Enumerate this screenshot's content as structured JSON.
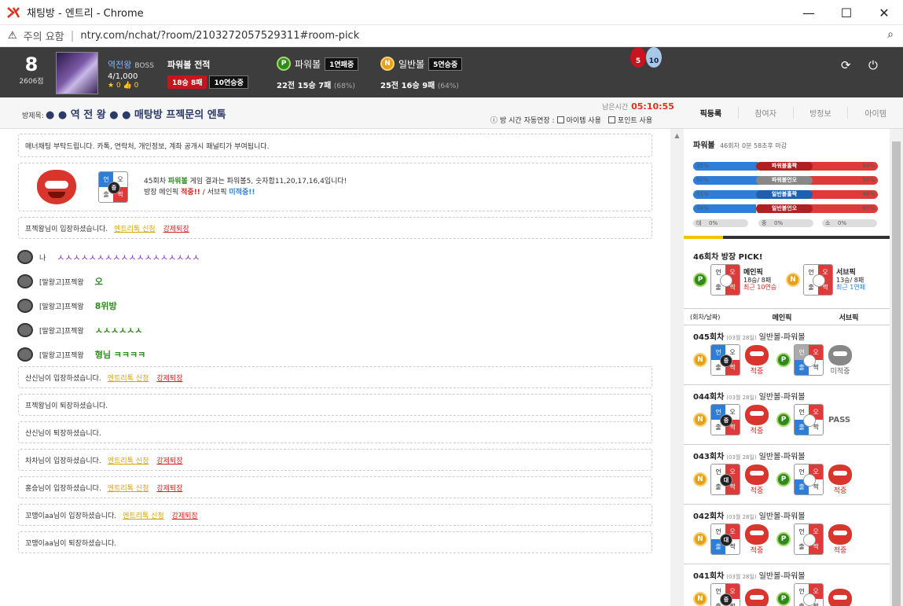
{
  "window": {
    "title": "채팅방 - 엔트리 - Chrome",
    "warning": "주의 요함",
    "url": "ntry.com/nchat/?room/2103272057529311#room-pick"
  },
  "user": {
    "level": "8",
    "points": "2606점",
    "name": "역전왕",
    "role": "BOSS",
    "members": "4/1,000",
    "stars": "0",
    "likes": "0"
  },
  "record": {
    "title": "파워볼 전적",
    "result": "18승 8패",
    "streak": "10연승중"
  },
  "powerball": {
    "ball": "P",
    "name": "파워볼",
    "streak": "1연패중",
    "summary": "22전 15승 7패",
    "pct": "(68%)"
  },
  "normalball": {
    "ball": "N",
    "name": "일반볼",
    "streak": "5연승중",
    "summary": "25전 16승 9패",
    "pct": "(64%)"
  },
  "medals": [
    "5",
    "10"
  ],
  "room": {
    "label": "방제목:",
    "title": "● ● 역 전 왕 ● ● 매탕방 프젝문의 엔톡",
    "remain_label": "남은시간",
    "remain": "05:10:55",
    "auto_label": "방 시간 자동연장 :",
    "opt1": "아이템 사용",
    "opt2": "포인트 사용"
  },
  "tabs": [
    "픽등록",
    "참여자",
    "방정보",
    "아이템"
  ],
  "chat": {
    "notice": "매너채팅 부탁드립니다. 카톡, 연락처, 개인정보, 계좌 공개시 패널티가 부여됩니다.",
    "result_line1_a": "45회차",
    "result_line1_b": "파워볼",
    "result_line1_c": "게임 결과는 파워볼5, 숫자합11,20,17,16,4입니다!",
    "result_line2_a": "방장 메인픽",
    "result_line2_b": "적중!!",
    "result_line2_c": "/ 서브픽",
    "result_line2_d": "미적중!!",
    "pick1": {
      "tl": "언",
      "tr": "오",
      "bl": "출",
      "br": "짝",
      "c": "중"
    },
    "link_apply": "엔트리톡 신청",
    "link_kick": "강제퇴장",
    "enter1": "프젝왕님이 입장하셨습니다.",
    "me_label": "나",
    "me_text": "ㅅㅅㅅㅅㅅㅅㅅㅅㅅㅅㅅㅅㅅㅅㅅㅅㅅㅅ",
    "user2": "[말왕고]프젝왕",
    "msg2": "오",
    "msg3": "8위방",
    "msg4": "ㅅㅅㅅㅅㅅㅅ",
    "msg5": "형님 ㅋㅋㅋㅋ",
    "enter2": "산신님이 입장하셨습니다.",
    "leave1": "프젝왕님이 퇴장하셨습니다.",
    "leave2": "산신님이 퇴장하셨습니다.",
    "enter3": "차차님이 입장하셨습니다.",
    "enter4": "홍승님이 입장하셨습니다.",
    "enter5": "꼬맹이aa님이 입장하셨습니다.",
    "leave3": "꼬맹이aa님이 퇴장하셨습니다."
  },
  "stats": {
    "title": "파워볼",
    "round": "46회차",
    "time": "0분 58초후 마감",
    "bars": [
      {
        "left": "35%",
        "right": "64%",
        "label": "파워볼홀짝",
        "l": 35,
        "r": 64
      },
      {
        "left": "50%",
        "right": "50%",
        "label": "파워볼언오",
        "l": 50,
        "r": 50
      },
      {
        "left": "51%",
        "right": "48%",
        "label": "일반볼홀짝",
        "l": 51,
        "r": 48
      },
      {
        "left": "34%",
        "right": "65%",
        "label": "일반볼언오",
        "l": 34,
        "r": 65
      }
    ],
    "mini": [
      {
        "icon": "대",
        "val": "0%"
      },
      {
        "icon": "중",
        "val": "0%"
      },
      {
        "icon": "소",
        "val": "0%"
      }
    ]
  },
  "pick": {
    "title": "46회차 방장 PICK!",
    "main": {
      "label": "메인픽",
      "rec": "18승/ 8패",
      "streak": "최근 10연승"
    },
    "sub": {
      "label": "서브픽",
      "rec": "13승/ 8패",
      "streak": "최근 1연패"
    }
  },
  "history": {
    "cols": [
      "(회차/날짜)",
      "메인픽",
      "서브픽"
    ],
    "rows": [
      {
        "round": "045회차",
        "date": "(03월 28일)",
        "game": "일반볼-파워볼",
        "main_c": "중",
        "main_res": "적중",
        "sub_res": "미적중"
      },
      {
        "round": "044회차",
        "date": "(03월 28일)",
        "game": "일반볼-파워볼",
        "main_c": "중",
        "main_res": "적중",
        "sub_res": "PASS"
      },
      {
        "round": "043회차",
        "date": "(03월 28일)",
        "game": "일반볼-파워볼",
        "main_c": "대",
        "main_res": "적중",
        "sub_res": "적중"
      },
      {
        "round": "042회차",
        "date": "(03월 28일)",
        "game": "일반볼-파워볼",
        "main_c": "대",
        "main_res": "적중",
        "sub_res": "적중"
      },
      {
        "round": "041회차",
        "date": "(03월 28일)",
        "game": "일반볼-파워볼",
        "main_c": "중",
        "main_res": "",
        "sub_res": ""
      }
    ]
  }
}
